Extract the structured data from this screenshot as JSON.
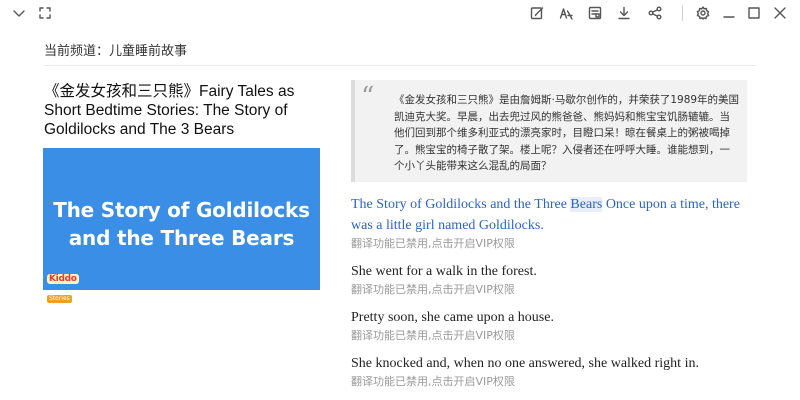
{
  "toolbar": {
    "left_icons": [
      "chevron-down-icon",
      "fullscreen-icon"
    ],
    "right_icons": [
      "edit-icon",
      "translate-icon",
      "reader-icon",
      "download-icon",
      "share-icon",
      "settings-icon",
      "minimize-icon",
      "maximize-icon",
      "close-icon"
    ]
  },
  "channel": {
    "label": "当前频道：儿童睡前故事"
  },
  "article": {
    "title": "《金发女孩和三只熊》Fairy Tales as Short Bedtime Stories: The Story of Goldilocks and The 3 Bears",
    "cover": {
      "line1": "The Story of Goldilocks",
      "line2": "and the Three Bears",
      "brand_top": "Kiddo",
      "brand_bottom": "Stories",
      "bg_color": "#3a8ee6"
    }
  },
  "summary": {
    "quote_mark": "“",
    "text": "《金发女孩和三只熊》是由詹姆斯·马歇尔创作的，并荣获了1989年的美国凯迪克大奖。早晨，出去兜过风的熊爸爸、熊妈妈和熊宝宝饥肠辘辘。当他们回到那个维多利亚式的漂亮家时，目瞪口呆！晾在餐桌上的粥被喝掉了。熊宝宝的椅子散了架。楼上呢？入侵者还在呼呼大睡。谁能想到，一个小丫头能带来这么混乱的局面？"
  },
  "paragraphs": [
    {
      "en_before": "The Story of Goldilocks and the Three ",
      "en_highlight": "Bears",
      "en_after": " Once upon a time, there was a little girl named Goldilocks.",
      "translation": "翻译功能已禁用,点击开启VIP权限",
      "active": true
    },
    {
      "en": "She went for a walk in the forest.",
      "translation": "翻译功能已禁用,点击开启VIP权限"
    },
    {
      "en": "Pretty soon, she came upon a house.",
      "translation": "翻译功能已禁用,点击开启VIP权限"
    },
    {
      "en": "She knocked and, when no one answered, she walked right in.",
      "translation": "翻译功能已禁用,点击开启VIP权限"
    }
  ],
  "colors": {
    "active_text": "#2b64c8",
    "translation_text": "#9a9a9a",
    "summary_bg": "#f2f2f2"
  }
}
